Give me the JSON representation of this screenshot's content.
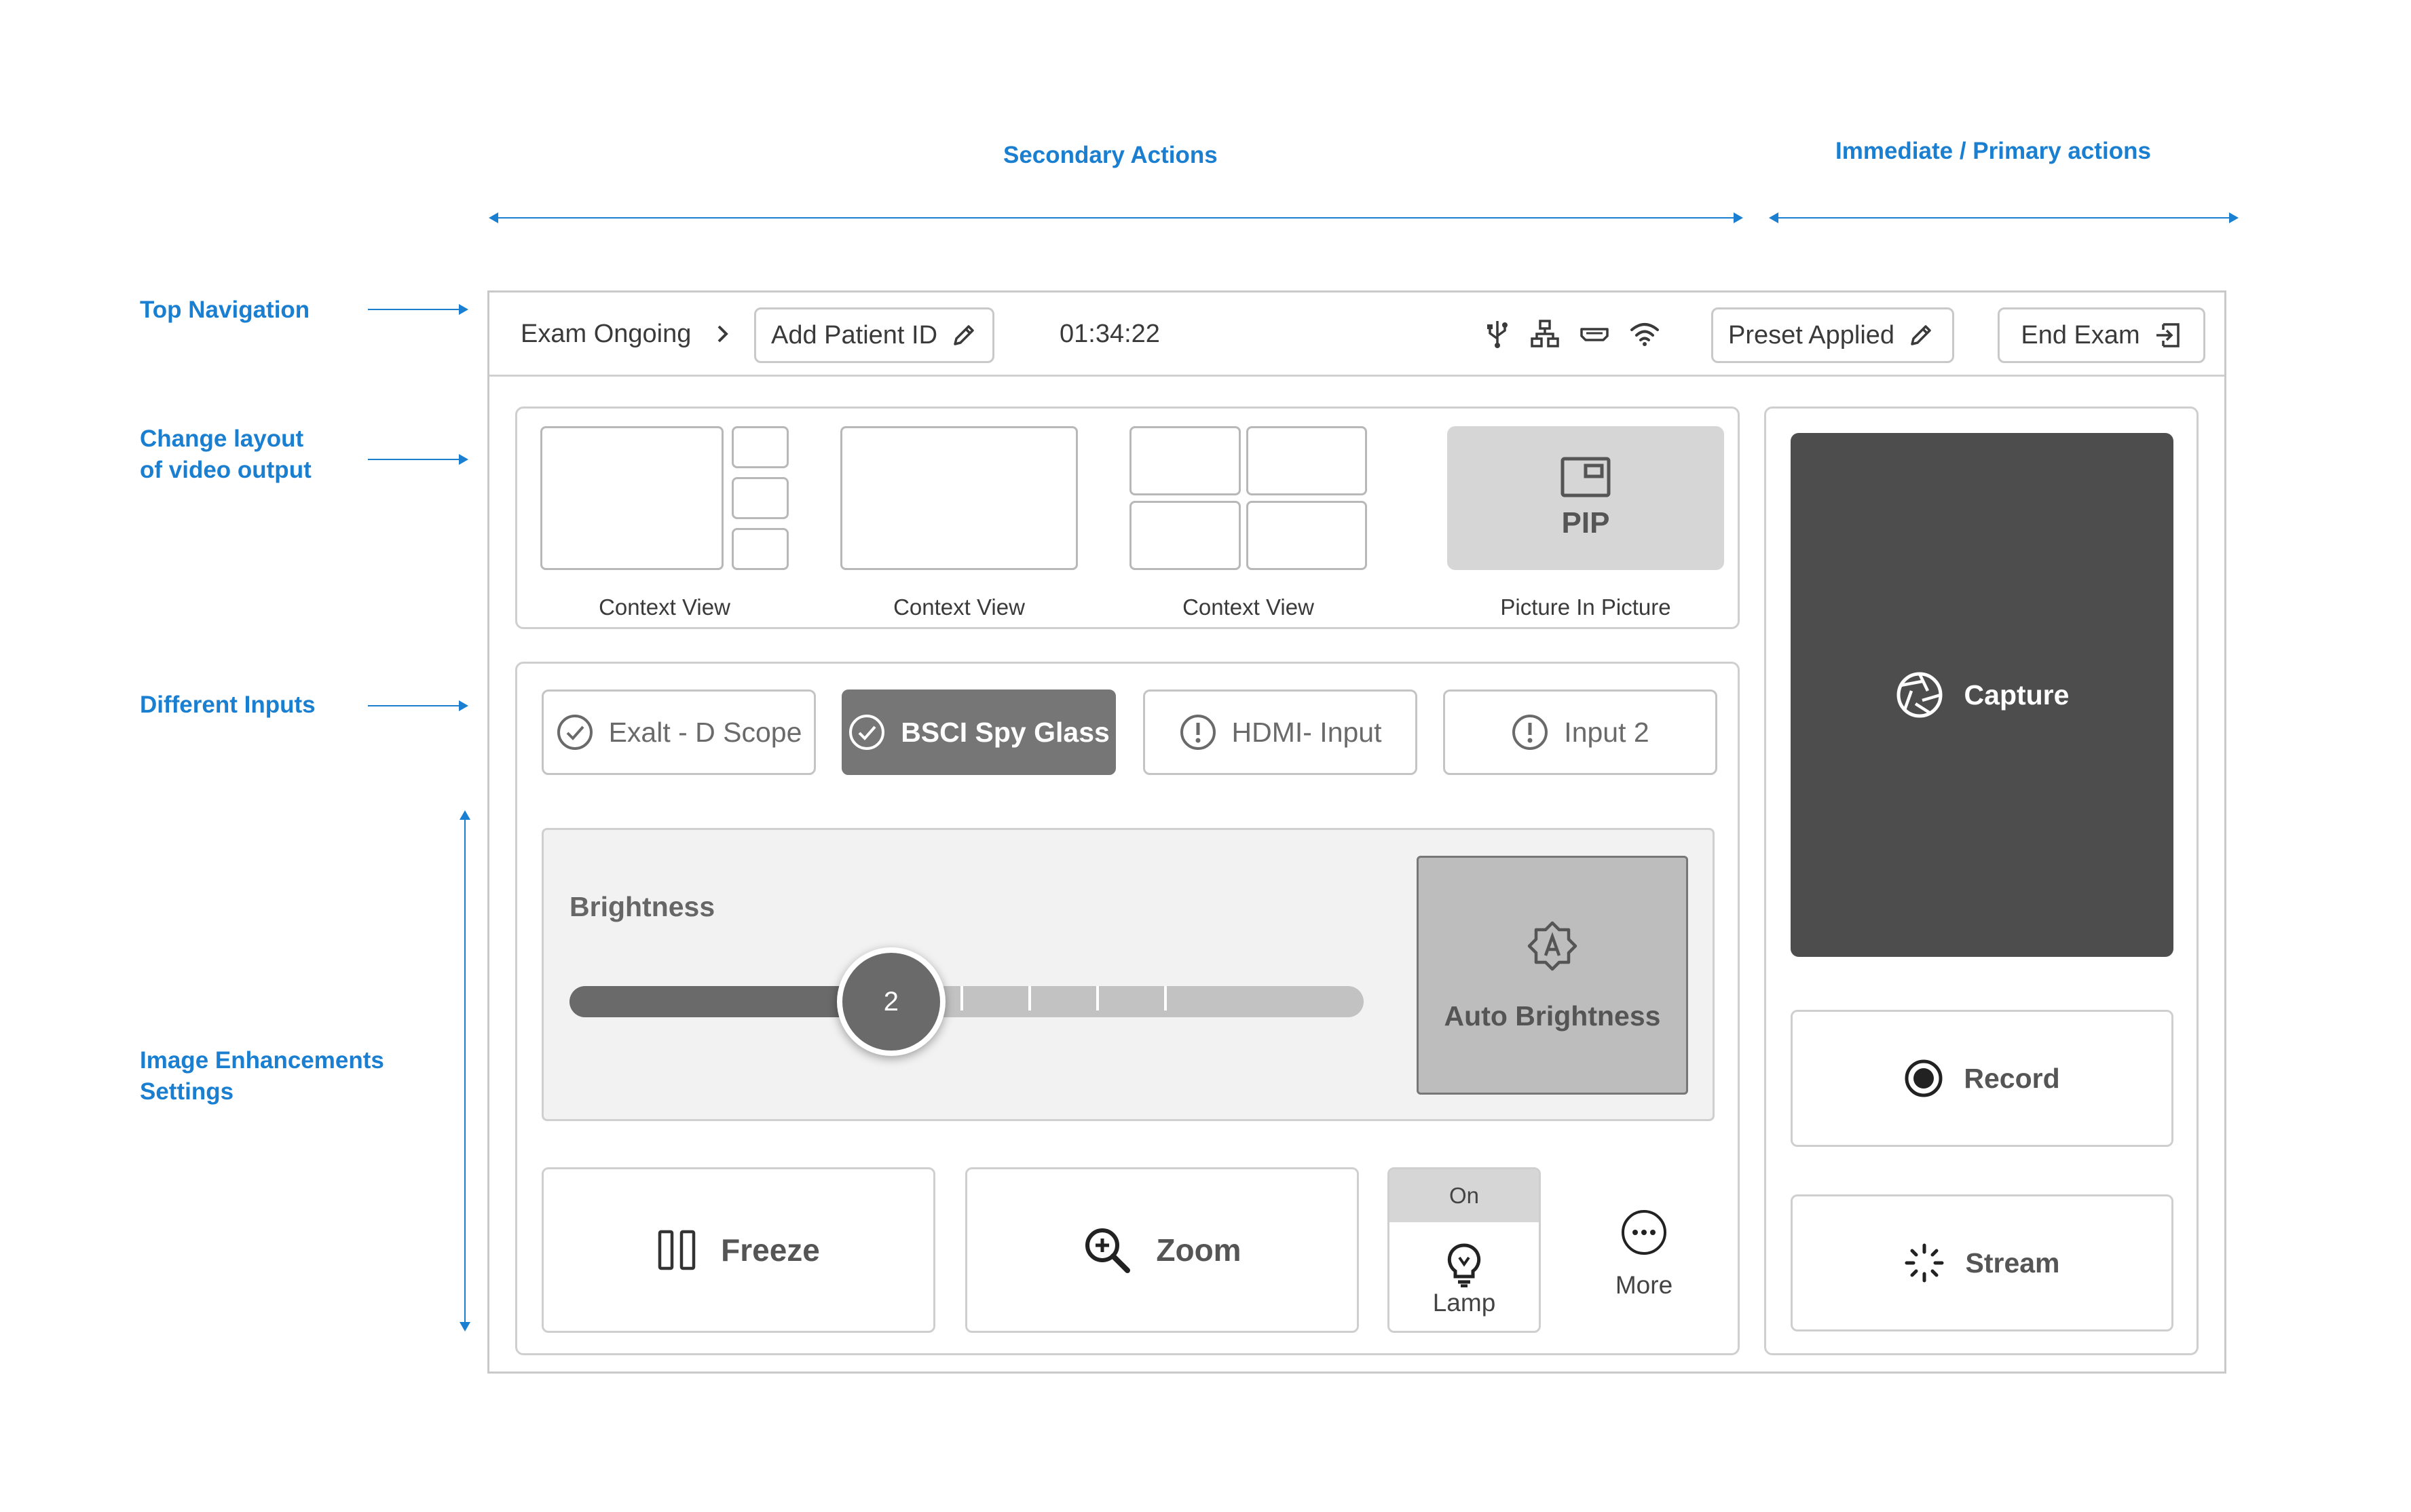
{
  "annotations": {
    "secondary_actions": "Secondary Actions",
    "primary_actions": "Immediate / Primary actions",
    "top_navigation": "Top Navigation",
    "change_layout_line1": "Change layout",
    "change_layout_line2": "of video output",
    "different_inputs": "Different Inputs",
    "image_enh_line1": "Image Enhancements",
    "image_enh_line2": "Settings"
  },
  "topbar": {
    "status": "Exam Ongoing",
    "add_patient": "Add Patient ID",
    "timer": "01:34:22",
    "preset": "Preset Applied",
    "end_exam": "End Exam",
    "icons": [
      "usb-icon",
      "network-icon",
      "hdmi-icon",
      "wifi-icon"
    ]
  },
  "layouts": {
    "items": [
      {
        "label": "Context View"
      },
      {
        "label": "Context View"
      },
      {
        "label": "Context View"
      },
      {
        "label": "Picture In Picture",
        "tile_text": "PIP"
      }
    ],
    "selected_index": 3
  },
  "inputs": {
    "items": [
      {
        "label": "Exalt - D Scope",
        "icon": "check-circle-icon",
        "selected": false
      },
      {
        "label": "BSCI Spy Glass",
        "icon": "check-circle-icon",
        "selected": true
      },
      {
        "label": "HDMI- Input",
        "icon": "alert-circle-icon",
        "selected": false
      },
      {
        "label": "Input 2",
        "icon": "alert-circle-icon",
        "selected": false
      }
    ]
  },
  "brightness": {
    "label": "Brightness",
    "value": "2",
    "level": 2,
    "max": 5,
    "auto_label": "Auto Brightness"
  },
  "controls": {
    "freeze": "Freeze",
    "zoom": "Zoom",
    "lamp_state": "On",
    "lamp": "Lamp",
    "more": "More"
  },
  "primary": {
    "capture": "Capture",
    "record": "Record",
    "stream": "Stream"
  },
  "colors": {
    "accent": "#1a7fd0",
    "capture_bg": "#4d4d4d",
    "selected_input": "#767676",
    "pip_bg": "#d6d6d6",
    "slider_fill": "#6a6a6a",
    "slider_track": "#c2c2c2"
  }
}
